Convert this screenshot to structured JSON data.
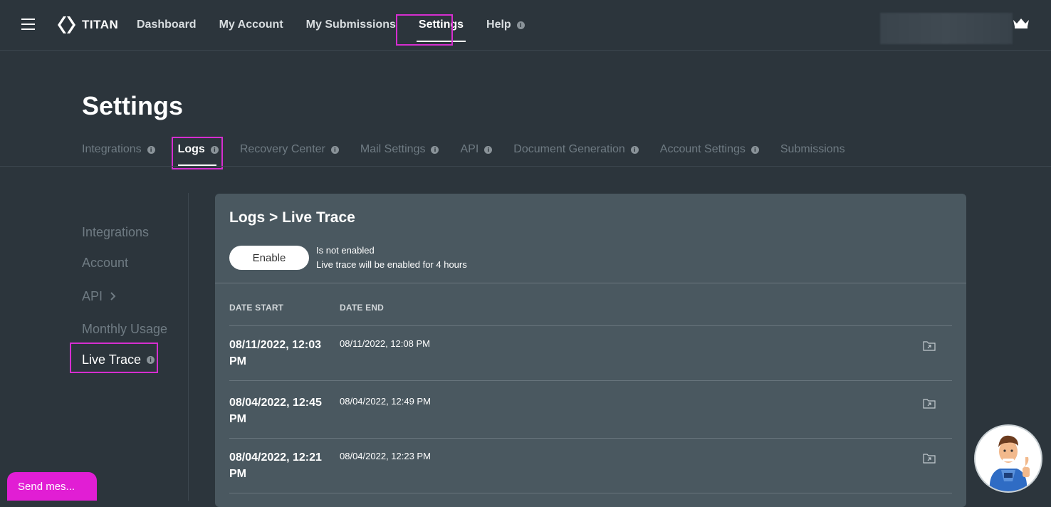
{
  "header": {
    "brand": "TITAN",
    "nav": [
      {
        "label": "Dashboard"
      },
      {
        "label": "My Account"
      },
      {
        "label": "My Submissions"
      },
      {
        "label": "Settings"
      },
      {
        "label": "Help"
      }
    ]
  },
  "page": {
    "title": "Settings"
  },
  "tabs": [
    {
      "label": "Integrations"
    },
    {
      "label": "Logs"
    },
    {
      "label": "Recovery Center"
    },
    {
      "label": "Mail Settings"
    },
    {
      "label": "API"
    },
    {
      "label": "Document Generation"
    },
    {
      "label": "Account Settings"
    },
    {
      "label": "Submissions"
    }
  ],
  "sidebar": {
    "items": [
      {
        "label": "Integrations"
      },
      {
        "label": "Account"
      },
      {
        "label": "API"
      },
      {
        "label": "Monthly Usage"
      },
      {
        "label": "Live Trace"
      }
    ]
  },
  "card": {
    "title": "Logs > Live Trace",
    "enable_label": "Enable",
    "status_line1": "Is not enabled",
    "status_line2": "Live trace will be enabled for 4 hours",
    "columns": [
      "DATE START",
      "DATE END"
    ],
    "rows": [
      {
        "start": "08/11/2022, 12:03 PM",
        "end": "08/11/2022, 12:08 PM"
      },
      {
        "start": "08/04/2022, 12:45 PM",
        "end": "08/04/2022, 12:49 PM"
      },
      {
        "start": "08/04/2022, 12:21 PM",
        "end": "08/04/2022, 12:23 PM"
      }
    ]
  },
  "chat": {
    "send_label": "Send mes..."
  },
  "icons": {
    "info": "i",
    "highlight_color": "#d62ed0",
    "chat_color": "#e11ed4"
  }
}
